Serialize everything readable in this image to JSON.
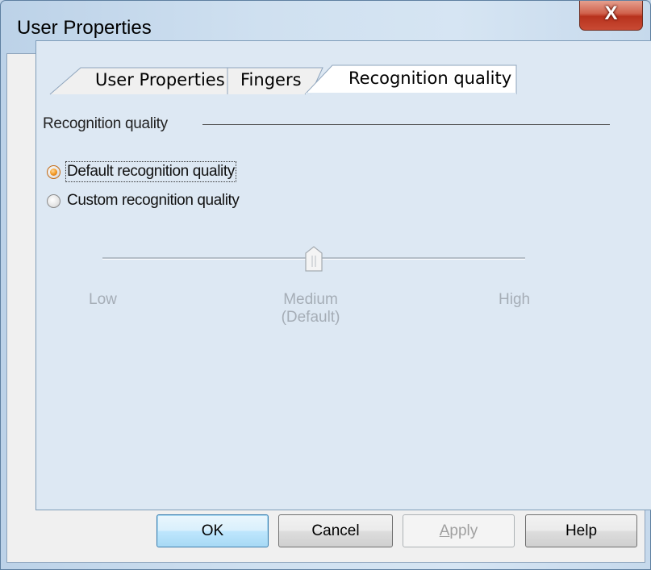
{
  "window": {
    "title": "User Properties",
    "close_glyph": "X"
  },
  "tabs": [
    {
      "label": "User Properties",
      "active": false
    },
    {
      "label": "Fingers",
      "active": false
    },
    {
      "label": "Recognition quality",
      "active": true
    }
  ],
  "group": {
    "title": "Recognition quality"
  },
  "options": [
    {
      "label": "Default recognition quality",
      "checked": true
    },
    {
      "label": "Custom recognition quality",
      "checked": false
    }
  ],
  "slider": {
    "enabled": false,
    "value": "Medium",
    "low_label": "Low",
    "medium_label": "Medium",
    "default_label": "(Default)",
    "high_label": "High"
  },
  "buttons": {
    "ok": "OK",
    "cancel": "Cancel",
    "apply_accel": "A",
    "apply_rest": "pply",
    "help": "Help"
  },
  "colors": {
    "accent": "#f39a24",
    "panel": "#dde8f3",
    "disabled_text": "#a5adb6"
  }
}
